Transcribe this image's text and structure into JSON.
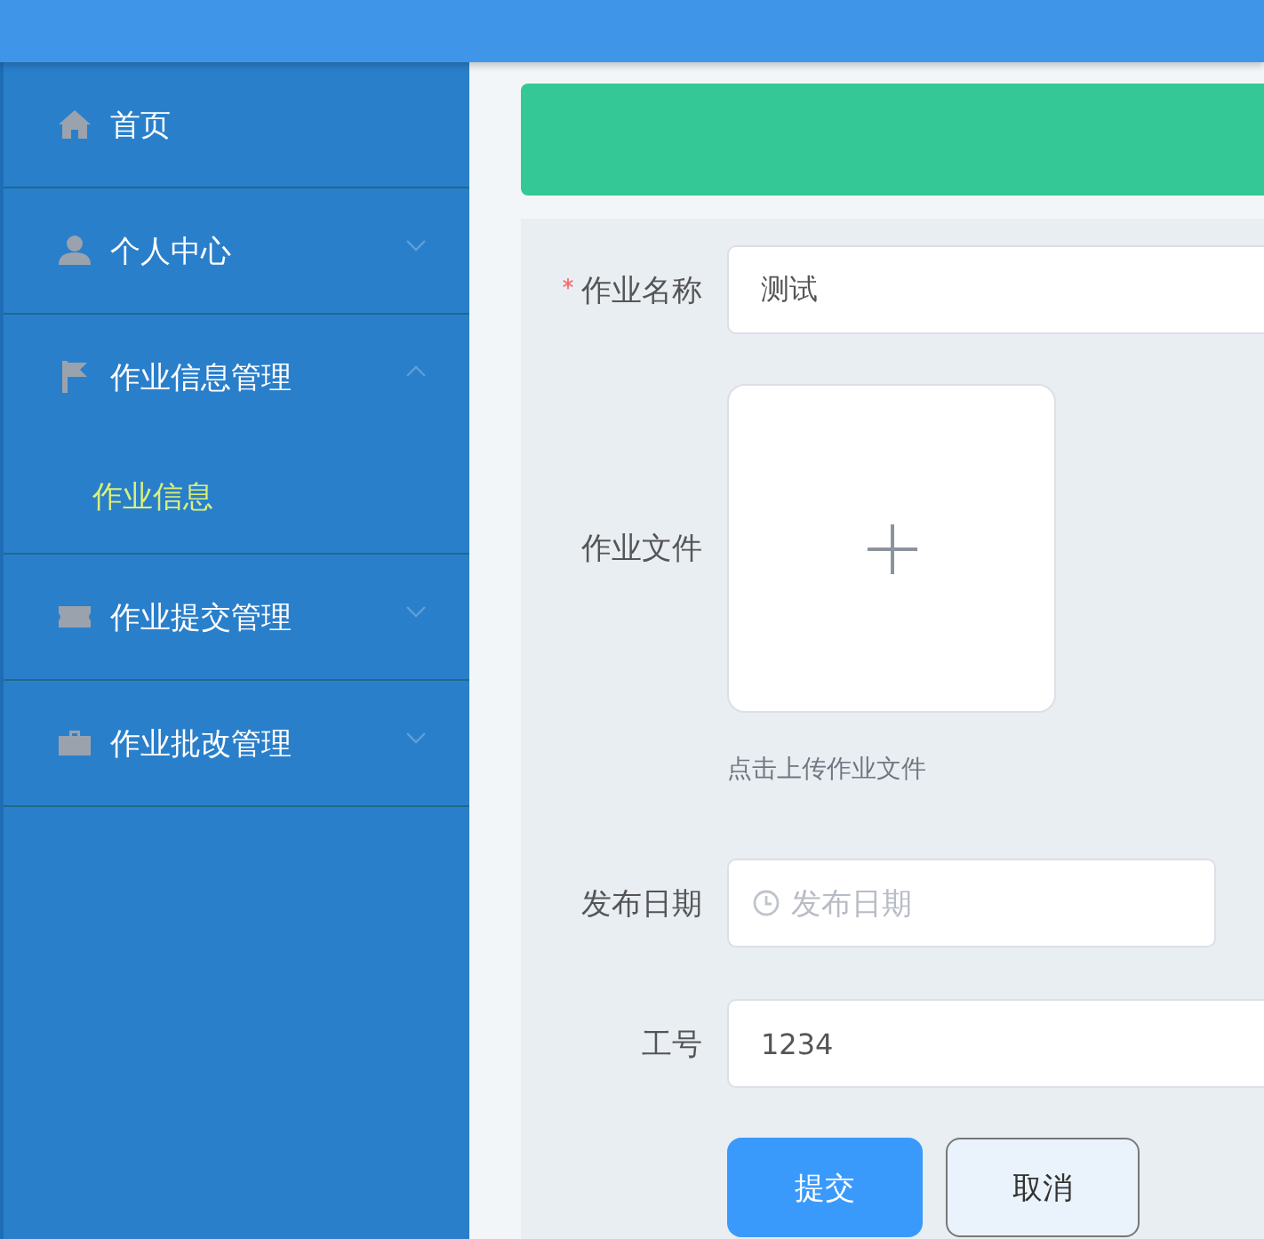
{
  "sidebar": {
    "items": [
      {
        "kind": "item",
        "label": "首页"
      },
      {
        "kind": "submenu",
        "label": "个人中心",
        "expanded": false
      },
      {
        "kind": "submenu",
        "label": "作业信息管理",
        "expanded": true,
        "children": [
          {
            "label": "作业信息",
            "selected": true
          }
        ]
      },
      {
        "kind": "submenu",
        "label": "作业提交管理",
        "expanded": false
      },
      {
        "kind": "submenu",
        "label": "作业批改管理",
        "expanded": false
      }
    ]
  },
  "form": {
    "fields": [
      {
        "kind": "text",
        "label": "作业名称",
        "required": true,
        "value": "测试"
      },
      {
        "kind": "upload",
        "label": "作业文件",
        "required": false,
        "hint": "点击上传作业文件"
      },
      {
        "kind": "date",
        "label": "发布日期",
        "required": false,
        "placeholder": "发布日期"
      },
      {
        "kind": "text",
        "label": "工号",
        "required": false,
        "value": "1234"
      }
    ],
    "buttons": [
      {
        "kind": "primary",
        "label": "提交"
      },
      {
        "kind": "default",
        "label": "取消"
      }
    ]
  }
}
